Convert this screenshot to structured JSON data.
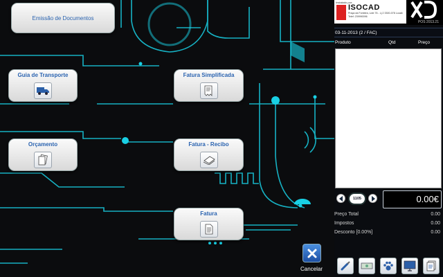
{
  "main": {
    "buttons": {
      "emissao": "Emissão de Documentos",
      "guia": "Guia de Transporte",
      "fatura_simplificada": "Fatura Simplificada",
      "orcamento": "Orçamento",
      "fatura_recibo": "Fatura - Recibo",
      "fatura": "Fatura"
    },
    "cancel_label": "Cancelar"
  },
  "panel": {
    "company": {
      "preheader": "Instalado por:",
      "name": "ISOCAD",
      "address": "Praça da Fonteira, Lote 76 - Lj 2 3300-078 Lousã Telef: 239990096"
    },
    "brand_mark": "XD",
    "version": "POS 2013.21",
    "document_line": "03-11-2013 (2 / FAC)",
    "columns": {
      "product": "Produto",
      "qty": "Qtd",
      "price": "Preço"
    },
    "page_number": "1105",
    "total": "0.00€",
    "summary": [
      {
        "label": "Preço Total",
        "value": "0.00"
      },
      {
        "label": "Impostos",
        "value": "0.00"
      },
      {
        "label": "Desconto [0.00%]",
        "value": "0.00"
      }
    ],
    "toolbar_icons": [
      "brush-icon",
      "money-icon",
      "paw-icon",
      "monitor-icon",
      "documents-icon"
    ]
  },
  "colors": {
    "accent": "#19d0e4",
    "background": "#0b0c0e",
    "button_text": "#2a63b0"
  }
}
